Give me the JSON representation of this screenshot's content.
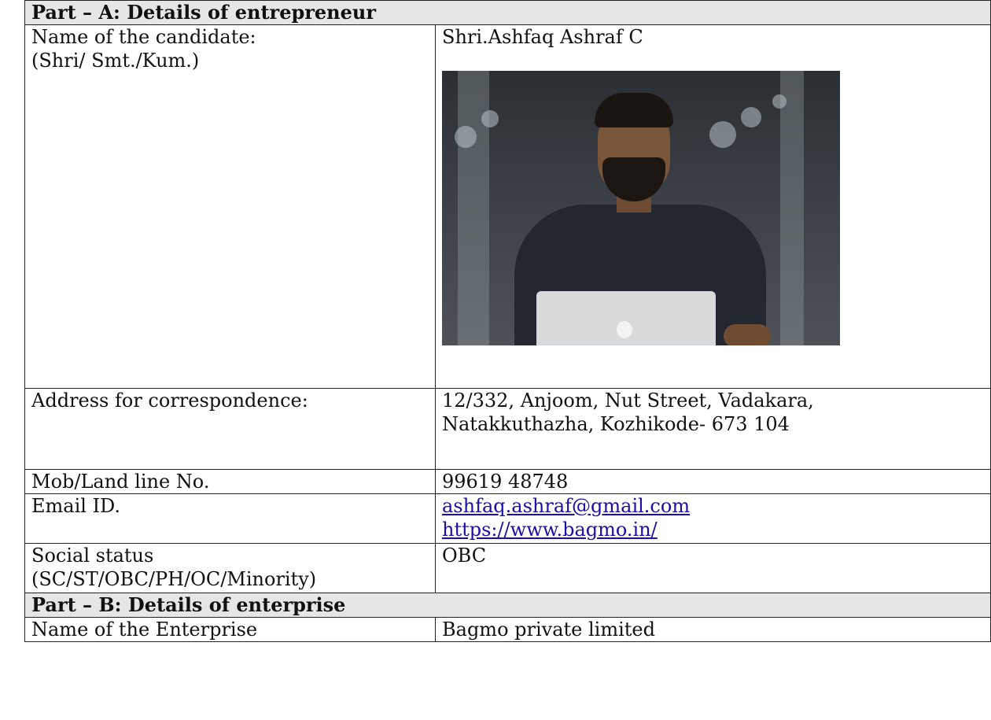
{
  "part_a": {
    "heading": "Part – A: Details of entrepreneur",
    "name_label_1": "Name of the candidate:",
    "name_label_2": "(Shri/ Smt./Kum.)",
    "name_value": "Shri.Ashfaq Ashraf C",
    "address_label": "Address for correspondence:",
    "address_line_1": "12/332, Anjoom, Nut Street, Vadakara,",
    "address_line_2": "Natakkuthazha, Kozhikode- 673 104",
    "phone_label": "Mob/Land line No.",
    "phone_value": "99619 48748",
    "email_label": "Email ID.",
    "email_value": "ashfaq.ashraf@gmail.com",
    "website_value": "https://www.bagmo.in/",
    "social_label_1": "Social status",
    "social_label_2": "(SC/ST/OBC/PH/OC/Minority)",
    "social_value": "OBC"
  },
  "part_b": {
    "heading": "Part – B: Details of enterprise",
    "enterprise_label": "Name of the Enterprise",
    "enterprise_value": "Bagmo private limited"
  }
}
